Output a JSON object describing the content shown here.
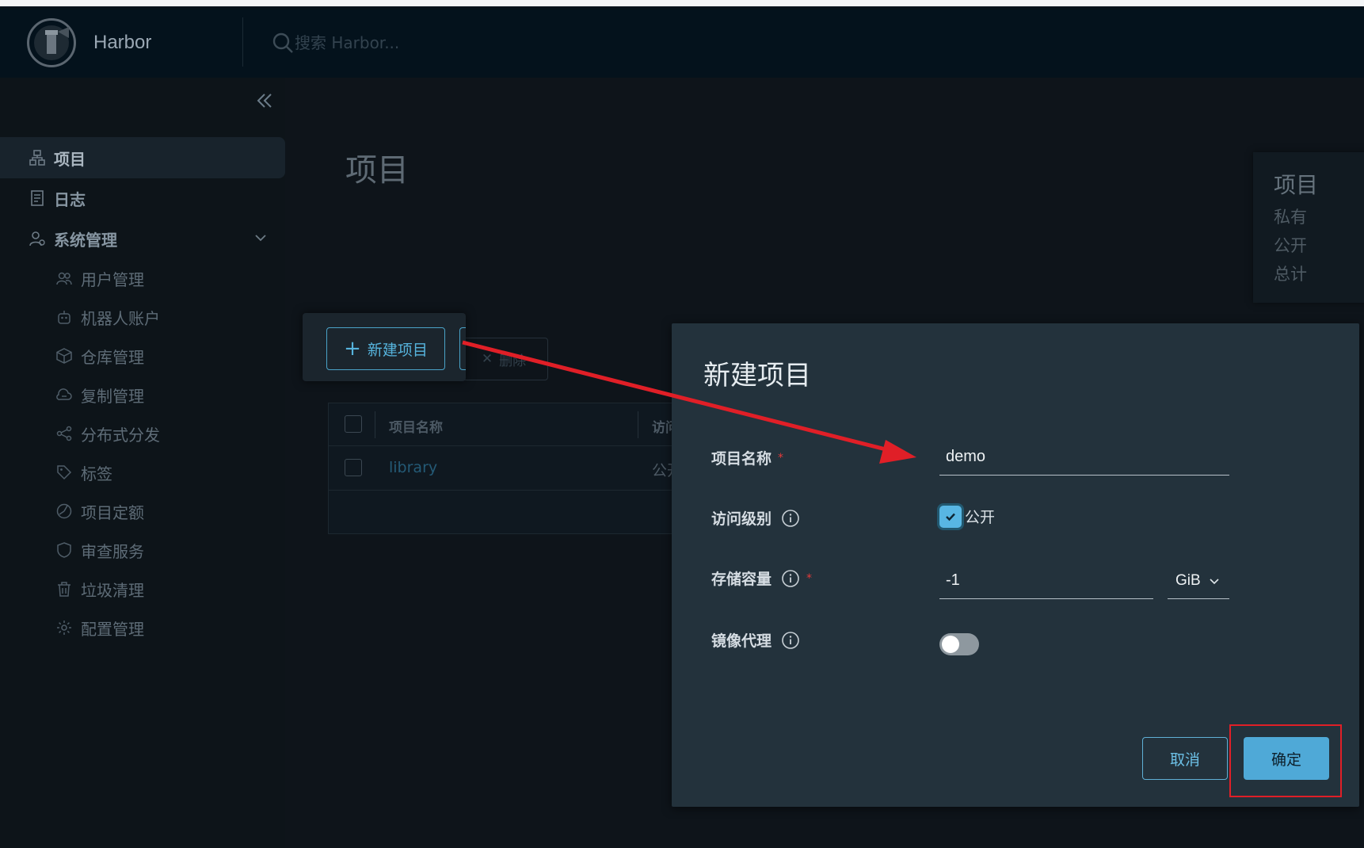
{
  "app": {
    "brand": "Harbor",
    "search_placeholder": "搜索 Harbor..."
  },
  "sidebar": {
    "items": [
      {
        "label": "项目",
        "icon": "projects-icon",
        "active": true
      },
      {
        "label": "日志",
        "icon": "logs-icon"
      },
      {
        "label": "系统管理",
        "icon": "admin-icon",
        "expanded": true
      }
    ],
    "sub_items": [
      {
        "label": "用户管理",
        "icon": "users-icon"
      },
      {
        "label": "机器人账户",
        "icon": "robot-icon"
      },
      {
        "label": "仓库管理",
        "icon": "registry-icon"
      },
      {
        "label": "复制管理",
        "icon": "replication-icon"
      },
      {
        "label": "分布式分发",
        "icon": "distribution-icon"
      },
      {
        "label": "标签",
        "icon": "tag-icon"
      },
      {
        "label": "项目定额",
        "icon": "quota-icon"
      },
      {
        "label": "审查服务",
        "icon": "shield-icon"
      },
      {
        "label": "垃圾清理",
        "icon": "trash-icon"
      },
      {
        "label": "配置管理",
        "icon": "gear-icon"
      }
    ]
  },
  "main": {
    "title": "项目",
    "stats": {
      "title": "项目",
      "rows": [
        "私有",
        "公开",
        "总计"
      ]
    },
    "toolbar": {
      "new_project": "新建项目",
      "delete": "删除"
    },
    "table": {
      "headers": [
        "项目名称",
        "访问"
      ],
      "rows": [
        {
          "name": "library",
          "access": "公开"
        }
      ]
    }
  },
  "dialog": {
    "title": "新建项目",
    "fields": {
      "name": {
        "label": "项目名称",
        "value": "demo"
      },
      "access": {
        "label": "访问级别",
        "checkbox_label": "公开",
        "checked": true
      },
      "storage": {
        "label": "存储容量",
        "value": "-1",
        "unit": "GiB"
      },
      "proxy": {
        "label": "镜像代理",
        "enabled": false
      }
    },
    "buttons": {
      "cancel": "取消",
      "ok": "确定"
    }
  },
  "colors": {
    "accent": "#4fa9d7",
    "annotation": "#e01f27",
    "modal_bg": "#23323c"
  }
}
